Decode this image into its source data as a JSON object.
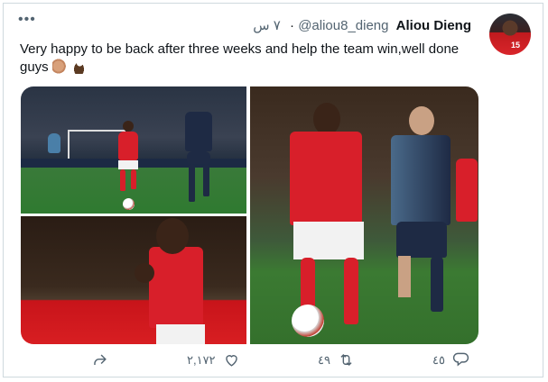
{
  "tweet": {
    "author_name": "Aliou Dieng",
    "handle": "@aliou8_dieng",
    "time": "٧ س",
    "text": "Very happy to be back after three weeks and help the team win,well done guys",
    "emojis": [
      "flexed-biceps",
      "eagle"
    ],
    "avatar_number": "15"
  },
  "actions": {
    "reply_count": "٤٥",
    "retweet_count": "٤٩",
    "like_count": "٢,١٧٢"
  },
  "icons": [
    "more-icon",
    "reply-icon",
    "retweet-icon",
    "like-icon",
    "share-icon"
  ],
  "colors": {
    "text": "#0f1419",
    "secondary": "#536471",
    "border": "#cfd9de",
    "red_kit": "#d81f2a",
    "navy_kit": "#1e2a44"
  }
}
